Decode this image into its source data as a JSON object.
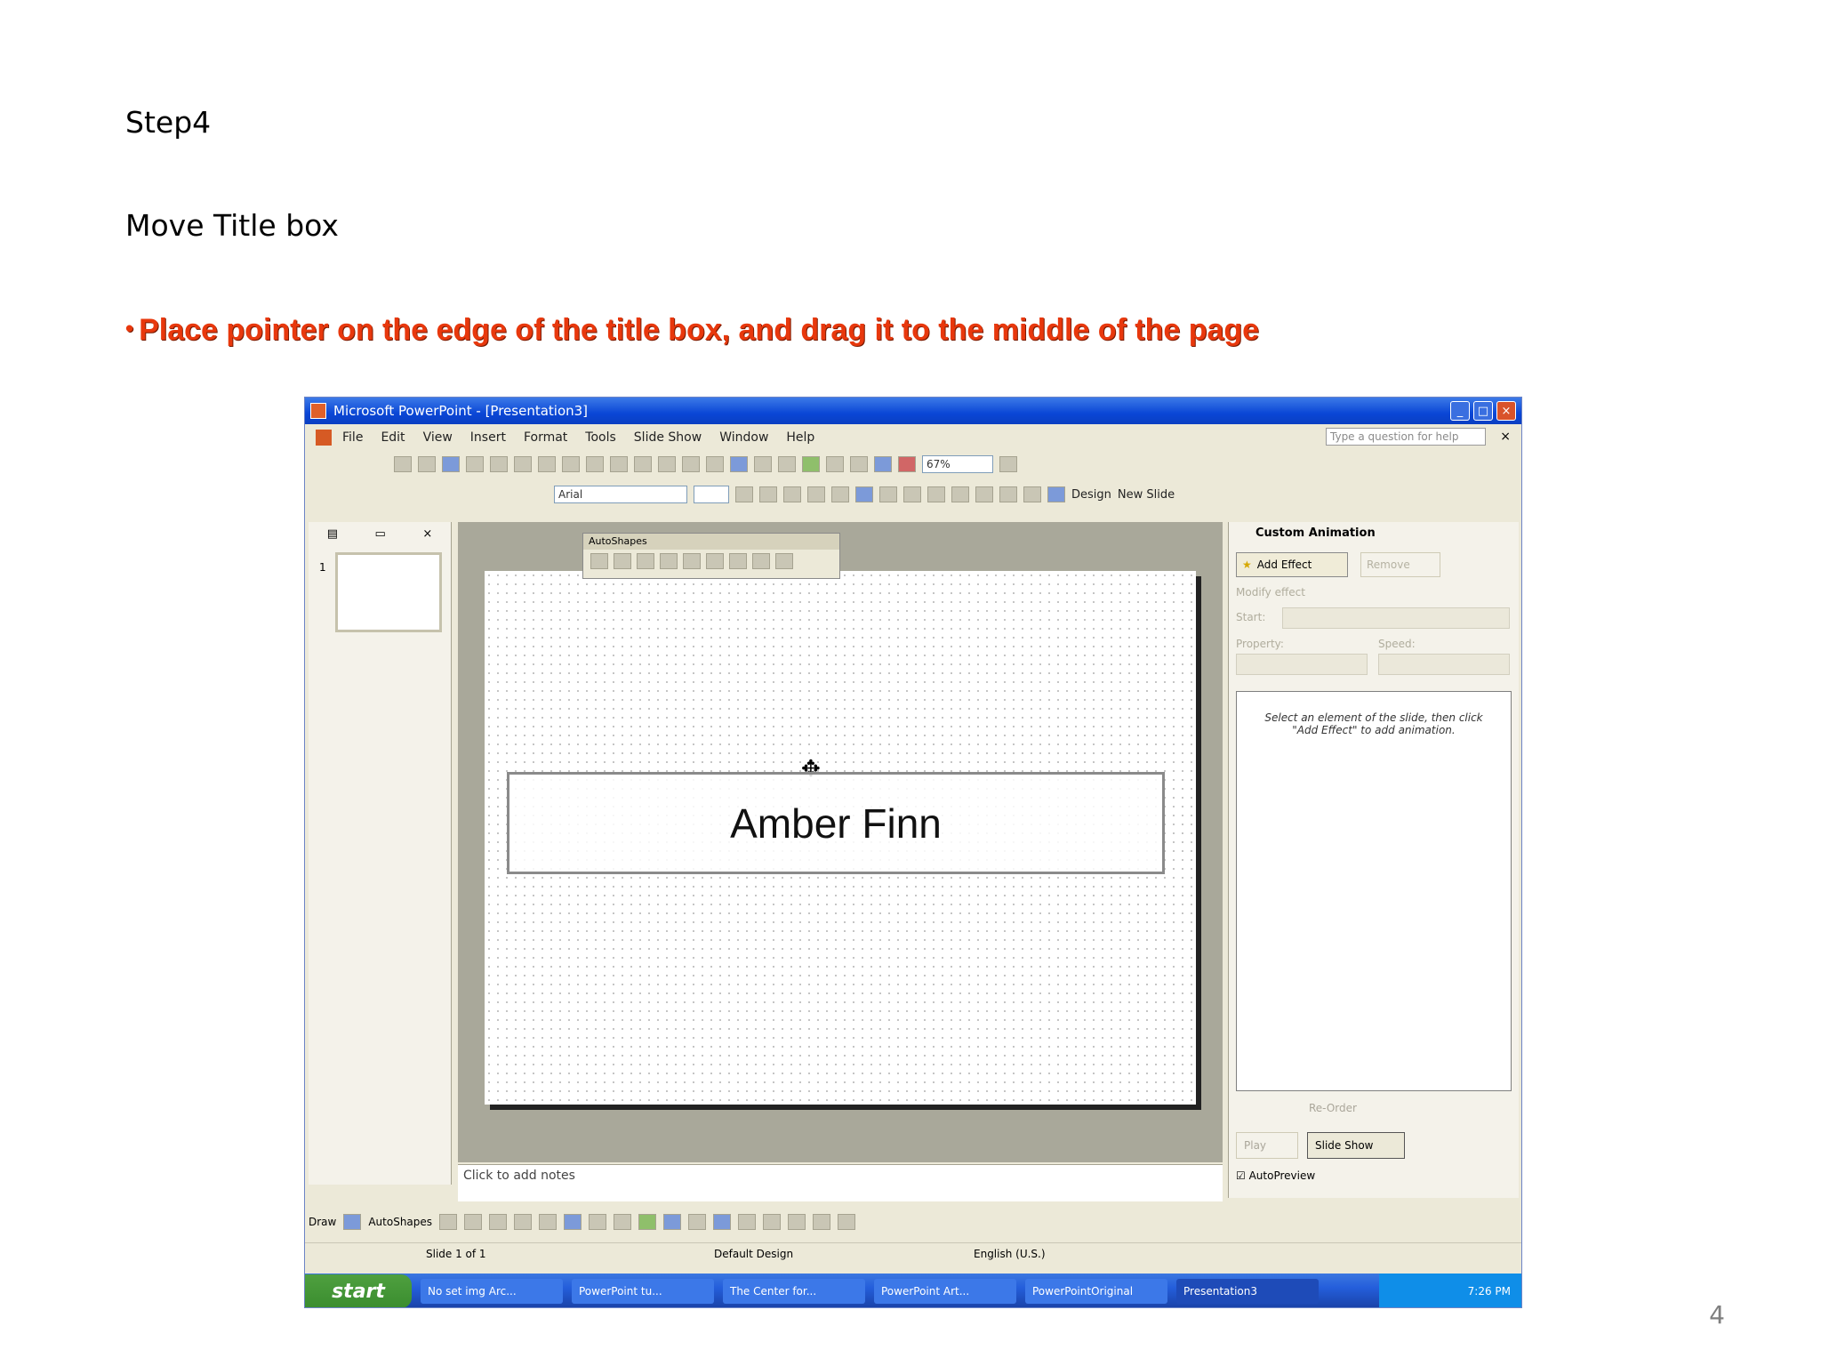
{
  "slide": {
    "step": "Step4",
    "subtitle": "Move Title box",
    "instruction": "Place pointer on the edge of the title box, and drag it to the middle of the page",
    "bullet": "•",
    "page_number": "4"
  },
  "window": {
    "title": "Microsoft PowerPoint - [Presentation3]",
    "menu": [
      "File",
      "Edit",
      "View",
      "Insert",
      "Format",
      "Tools",
      "Slide Show",
      "Window",
      "Help"
    ],
    "help_placeholder": "Type a question for help",
    "font_name": "Arial",
    "zoom": "67%",
    "design_label": "Design",
    "new_slide_label": "New Slide"
  },
  "canvas": {
    "title_text": "Amber Finn",
    "autoshapes_title": "AutoShapes",
    "notes_placeholder": "Click to add notes"
  },
  "taskpane": {
    "title": "Custom Animation",
    "add_effect": "Add Effect",
    "remove": "Remove",
    "modify_label": "Modify effect",
    "start_label": "Start:",
    "property_label": "Property:",
    "speed_label": "Speed:",
    "hint": "Select an element of the slide, then click \"Add Effect\" to add animation.",
    "reorder": "Re-Order",
    "play": "Play",
    "slide_show": "Slide Show",
    "autopreview": "AutoPreview"
  },
  "drawbar": {
    "draw": "Draw",
    "autoshapes": "AutoShapes"
  },
  "status": {
    "slide": "Slide 1 of 1",
    "design": "Default Design",
    "language": "English (U.S.)"
  },
  "taskbar": {
    "start": "start",
    "items": [
      "No set img Arc...",
      "PowerPoint tu...",
      "The Center for...",
      "PowerPoint Art...",
      "PowerPointOriginal",
      "Presentation3"
    ],
    "clock": "7:26 PM"
  }
}
